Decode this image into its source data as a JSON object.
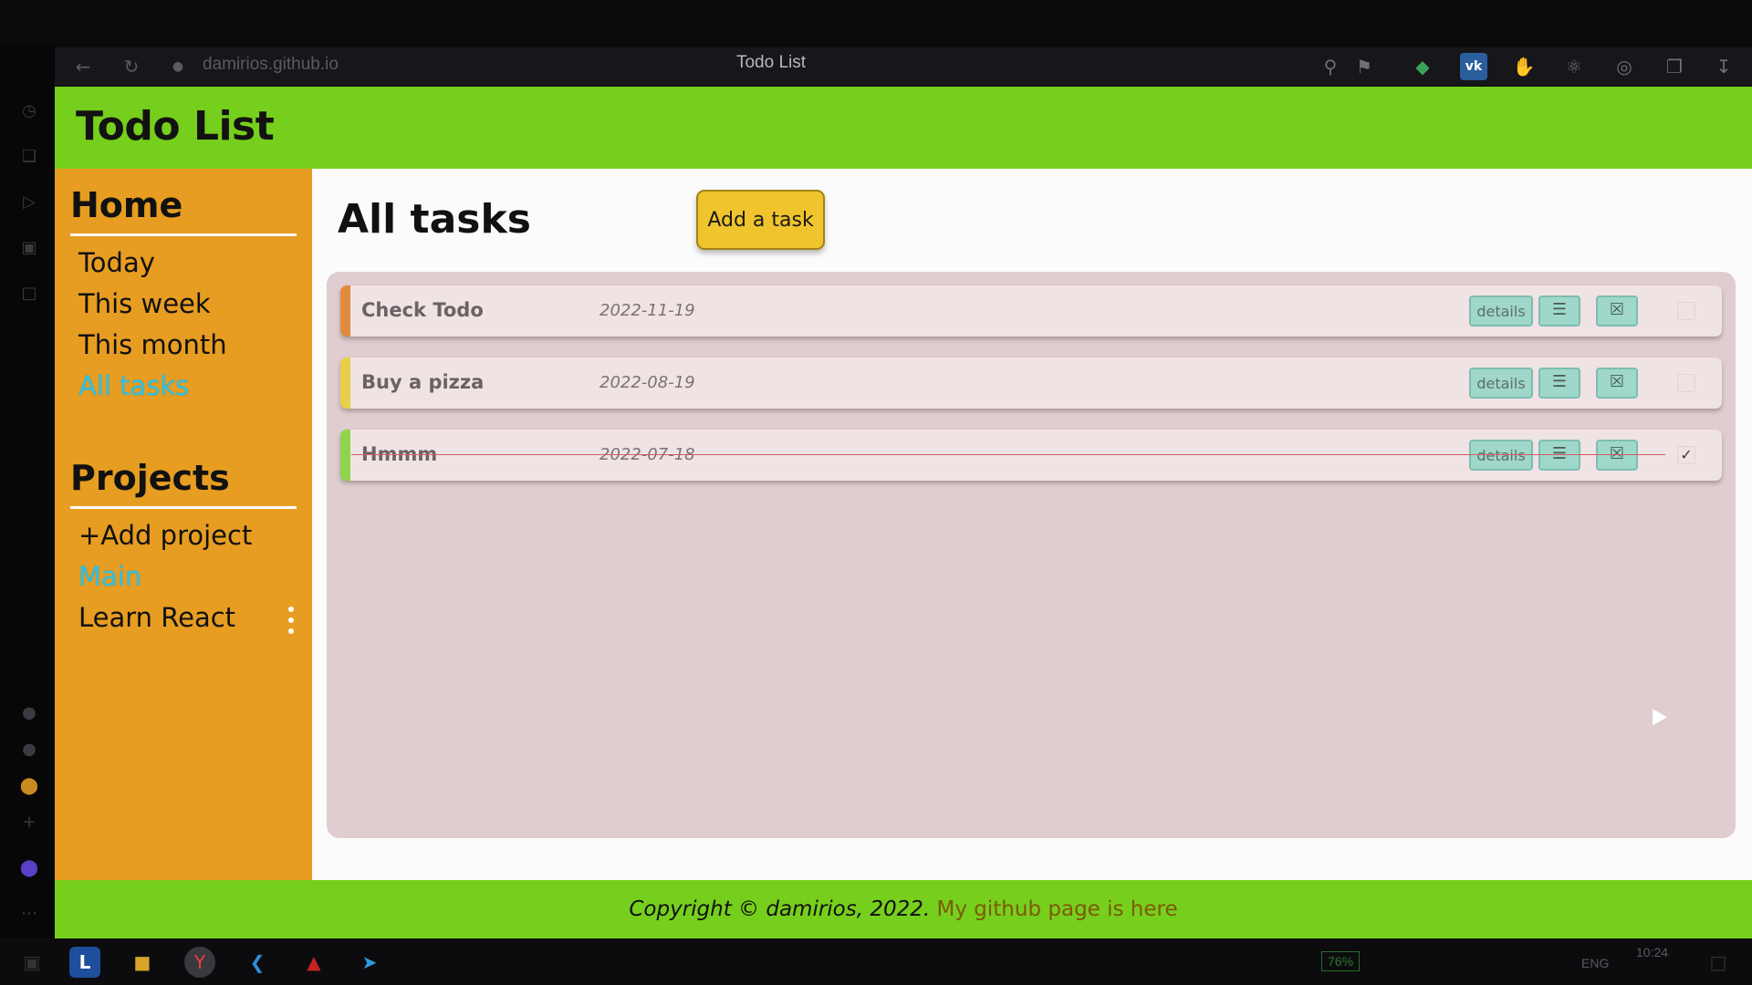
{
  "browser": {
    "url": "damirios.github.io",
    "tab_title": "Todo List",
    "icons": [
      "back-icon",
      "reload-icon",
      "lock-icon",
      "search-icon",
      "bookmark-icon",
      "extension-icon",
      "vk-icon",
      "adblock-icon",
      "settings-icon",
      "record-icon",
      "collections-icon",
      "download-icon"
    ]
  },
  "app": {
    "title": "Todo List",
    "sidebar": {
      "home_heading": "Home",
      "home_items": [
        {
          "label": "Today"
        },
        {
          "label": "This week"
        },
        {
          "label": "This month"
        },
        {
          "label": "All tasks",
          "active": true
        }
      ],
      "projects_heading": "Projects",
      "add_project": "+Add project",
      "projects": [
        {
          "label": "Main",
          "active": true
        },
        {
          "label": "Learn React"
        }
      ]
    },
    "main": {
      "title": "All tasks",
      "add_button": "Add a task",
      "tasks": [
        {
          "name": "Check Todo",
          "date": "2022-11-19",
          "details_label": "details",
          "priority_color": "#e38b3d",
          "done": false
        },
        {
          "name": "Buy a pizza",
          "date": "2022-08-19",
          "details_label": "details",
          "priority_color": "#e8cf4a",
          "done": false
        },
        {
          "name": "Hmmm",
          "date": "2022-07-18",
          "details_label": "details",
          "priority_color": "#8fd44a",
          "done": true
        }
      ]
    },
    "footer": {
      "copyright": "Copyright © damirios, 2022.",
      "link_text": "My github page is here"
    }
  },
  "taskbar": {
    "battery": "76%",
    "lang": "ENG",
    "time": "10:24"
  },
  "colors": {
    "header_green": "#76cf1c",
    "sidebar_orange": "#e79d21",
    "active_link": "#36c0e0",
    "add_button": "#f0c42c",
    "task_panel": "#dfcdcf",
    "action_button": "#9fd8ca"
  }
}
